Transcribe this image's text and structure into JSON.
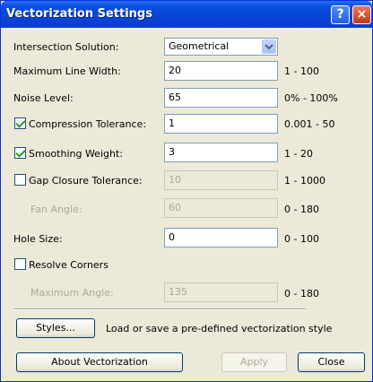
{
  "window": {
    "title": "Vectorization Settings",
    "help_button": "?",
    "close_button": "×"
  },
  "fields": {
    "intersection_solution": {
      "label": "Intersection Solution:",
      "value": "Geometrical"
    },
    "max_line_width": {
      "label": "Maximum Line Width:",
      "value": "20",
      "range": "1 - 100"
    },
    "noise_level": {
      "label": "Noise Level:",
      "value": "65",
      "range": "0% - 100%"
    },
    "compression_tolerance": {
      "label": "Compression Tolerance:",
      "checked": true,
      "value": "1",
      "range": "0.001 - 50"
    },
    "smoothing_weight": {
      "label": "Smoothing Weight:",
      "checked": true,
      "value": "3",
      "range": "1 - 20"
    },
    "gap_closure_tolerance": {
      "label": "Gap Closure Tolerance:",
      "checked": false,
      "value": "10",
      "range": "1 - 1000"
    },
    "fan_angle": {
      "label": "Fan Angle:",
      "value": "60",
      "range": "0 - 180"
    },
    "hole_size": {
      "label": "Hole Size:",
      "value": "0",
      "range": "0 - 100"
    },
    "resolve_corners": {
      "label": "Resolve Corners",
      "checked": false
    },
    "maximum_angle": {
      "label": "Maximum Angle:",
      "value": "135",
      "range": "0 - 180"
    }
  },
  "styles": {
    "button_label": "Styles...",
    "description": "Load or save a pre-defined vectorization style"
  },
  "footer": {
    "about_label": "About Vectorization",
    "apply_label": "Apply",
    "close_label": "Close"
  }
}
